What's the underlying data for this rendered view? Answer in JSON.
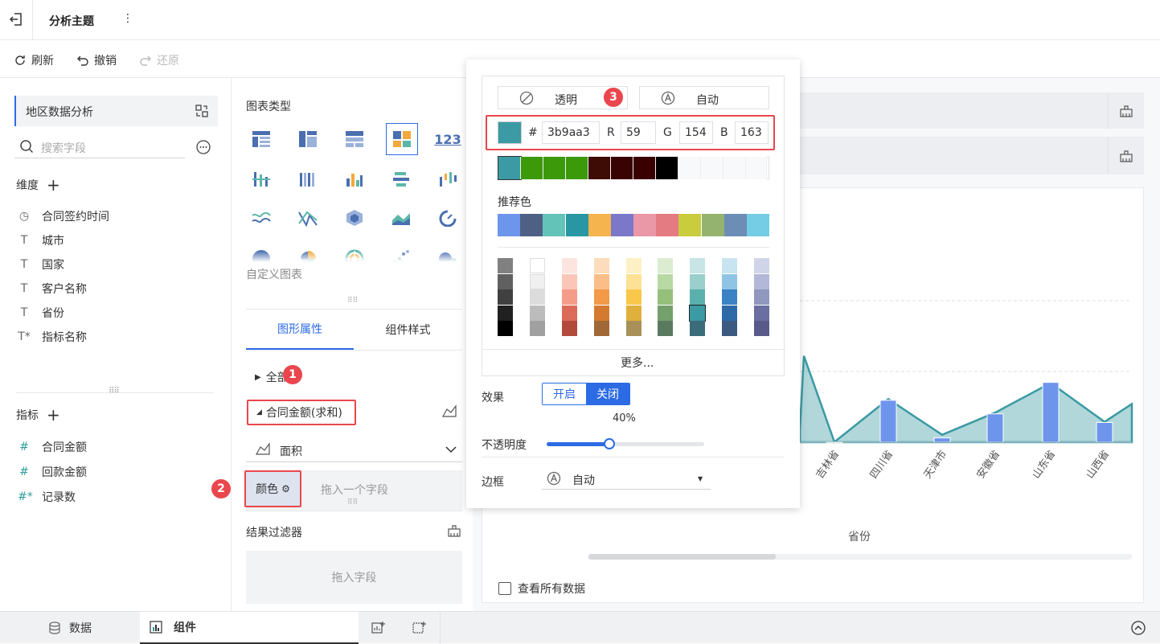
{
  "topbar": {
    "title": "分析主题",
    "more": "⋮"
  },
  "toolbar": {
    "refresh": "刷新",
    "undo": "撤销",
    "redo": "还原"
  },
  "left": {
    "dataset": "地区数据分析",
    "search_placeholder": "搜索字段",
    "dims_label": "维度",
    "dims": [
      "合同签约时间",
      "城市",
      "国家",
      "客户名称",
      "省份",
      "指标名称"
    ],
    "measures_label": "指标",
    "measures": [
      "合同金额",
      "回款金额",
      "记录数"
    ]
  },
  "mid": {
    "chart_type_label": "图表类型",
    "custom_chart": "自定义图表",
    "tabs": [
      "图形属性",
      "组件样式"
    ],
    "all_label": "全部",
    "measure_label": "合同金额(求和)",
    "graph_type": "面积",
    "color_label": "颜色",
    "drop_one": "拖入一个字段",
    "filter_label": "结果过滤器",
    "drop_field": "拖入字段"
  },
  "badges": [
    "1",
    "2",
    "3"
  ],
  "popup": {
    "transparent": "透明",
    "auto": "自动",
    "hash": "#",
    "hex": "3b9aa3",
    "r_label": "R",
    "r": "59",
    "g_label": "G",
    "g": "154",
    "b_label": "B",
    "b": "163",
    "current": "#3b9aa3",
    "recent_colors": [
      "#3b9aa3",
      "#3c9a0a",
      "#3c9a0a",
      "#3c9a0a",
      "#3e0c05",
      "#3a0303",
      "#3a0000",
      "#000000",
      "#f8f9fa",
      "#f8f9fa",
      "#f8f9fa",
      "#f8f9fa"
    ],
    "recommend_label": "推荐色",
    "recommend": [
      "#6e95ec",
      "#4e6185",
      "#64c3b8",
      "#2896a3",
      "#f6b44e",
      "#7b78c9",
      "#ea97a8",
      "#e57b82",
      "#c9cc3c",
      "#94b36e",
      "#6c8db5",
      "#74cde4"
    ],
    "grid": [
      [
        "#808080",
        "#606060",
        "#404040",
        "#202020",
        "#000000"
      ],
      [
        "#ffffff",
        "#f0f0f0",
        "#dcdcdc",
        "#bcbcbc",
        "#a0a0a0"
      ],
      [
        "#fde5df",
        "#fbc6b8",
        "#f59c88",
        "#dc6a58",
        "#b24a3c"
      ],
      [
        "#fcdcbc",
        "#fbbe88",
        "#f29a48",
        "#d47a30",
        "#a06836"
      ],
      [
        "#fdf0c4",
        "#fde194",
        "#f9c84a",
        "#e0b03c",
        "#a89058"
      ],
      [
        "#dcecd0",
        "#b8d8a4",
        "#94c07c",
        "#74a06c",
        "#5a7a60"
      ],
      [
        "#c8e4e4",
        "#9acfcc",
        "#5ab0ac",
        "#3b9aa3",
        "#3a6c7a"
      ],
      [
        "#c8e4f0",
        "#90c4e4",
        "#3a82c4",
        "#2e6aa8",
        "#3c5a80"
      ],
      [
        "#d0d4e8",
        "#b4b8d8",
        "#9098c0",
        "#6a6ea0",
        "#5a5a8a"
      ]
    ],
    "more": "更多...",
    "effect_label": "效果",
    "effect_on": "开启",
    "effect_off": "关闭",
    "opacity_value": "40%",
    "opacity_label": "不透明度",
    "opacity": 0.4,
    "border_label": "边框",
    "border_value": "自动"
  },
  "chart": {
    "xlabel": "省份",
    "xticks": [
      "吉林省",
      "四川省",
      "天津市",
      "安徽省",
      "山东省",
      "山西省"
    ],
    "show_all": "查看所有数据"
  },
  "chart_data": {
    "type": "area",
    "categories": [
      "吉林省",
      "四川省",
      "天津市",
      "安徽省",
      "山东省",
      "山西省"
    ],
    "series": [
      {
        "values": [
          0.3,
          68,
          7,
          46,
          97,
          32
        ]
      }
    ],
    "area_values": [
      0.3,
      70,
      12,
      48,
      96,
      33
    ],
    "xlabel": "省份",
    "ylim": [
      0,
      360
    ]
  },
  "bottom": {
    "data_tab": "数据",
    "component_tab": "组件"
  }
}
